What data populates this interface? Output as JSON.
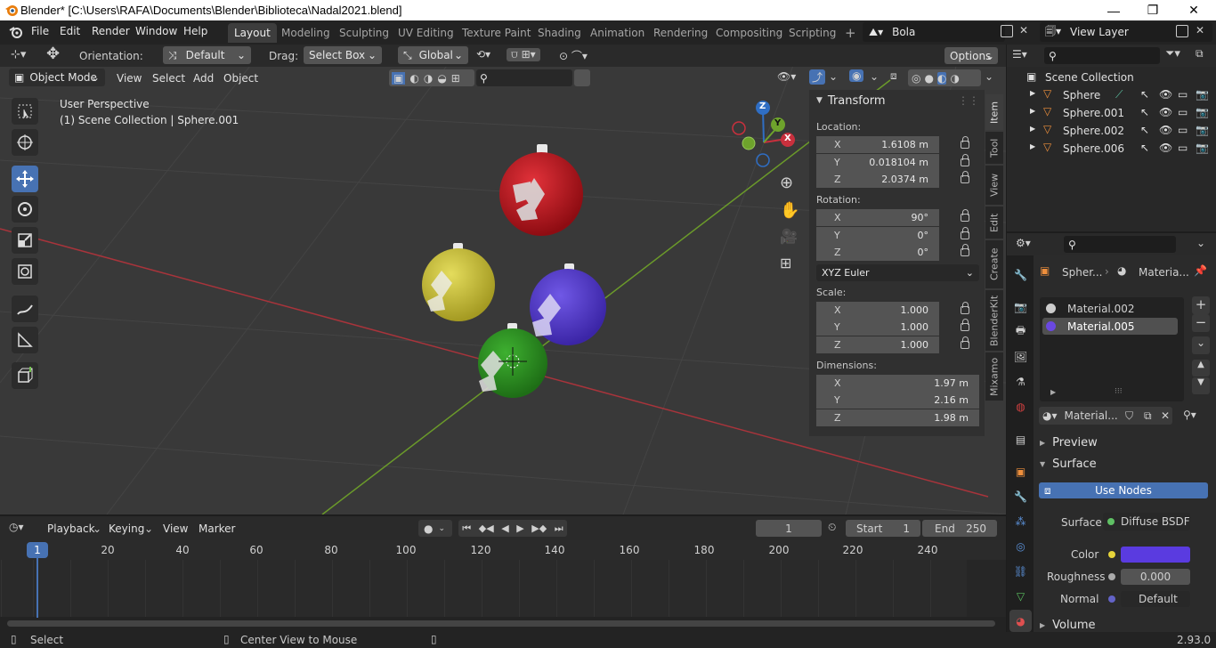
{
  "window": {
    "title": "Blender* [C:\\Users\\RAFA\\Documents\\Blender\\Biblioteca\\Nadal2021.blend]"
  },
  "menu": [
    "File",
    "Edit",
    "Render",
    "Window",
    "Help"
  ],
  "workspaces": [
    "Layout",
    "Modeling",
    "Sculpting",
    "UV Editing",
    "Texture Paint",
    "Shading",
    "Animation",
    "Rendering",
    "Compositing",
    "Scripting"
  ],
  "active_workspace": "Layout",
  "scene_name": "Bola",
  "view_layer": "View Layer",
  "tool_header": {
    "orientation_label": "Orientation:",
    "orientation_value": "Default",
    "drag_label": "Drag:",
    "drag_value": "Select Box",
    "transform_orientation": "Global",
    "options": "Options"
  },
  "viewport_header": {
    "mode": "Object Mode",
    "menus": [
      "View",
      "Select",
      "Add",
      "Object"
    ]
  },
  "viewport_info": {
    "perspective": "User Perspective",
    "collection": "(1) Scene Collection | Sphere.001"
  },
  "gizmo": {
    "x": "X",
    "y": "Y",
    "z": "Z"
  },
  "n_panel": {
    "header": "Transform",
    "location_label": "Location:",
    "location": {
      "x": "1.6108 m",
      "y": "0.018104 m",
      "z": "2.0374 m"
    },
    "rotation_label": "Rotation:",
    "rotation": {
      "x": "90°",
      "y": "0°",
      "z": "0°"
    },
    "rotation_mode": "XYZ Euler",
    "scale_label": "Scale:",
    "scale": {
      "x": "1.000",
      "y": "1.000",
      "z": "1.000"
    },
    "dimensions_label": "Dimensions:",
    "dimensions": {
      "x": "1.97 m",
      "y": "2.16 m",
      "z": "1.98 m"
    },
    "axis": {
      "x": "X",
      "y": "Y",
      "z": "Z"
    },
    "tabs": [
      "Item",
      "Tool",
      "View",
      "Edit",
      "Create",
      "BlenderKit",
      "Mixamo"
    ]
  },
  "outliner": {
    "root": "Scene Collection",
    "items": [
      "Sphere",
      "Sphere.001",
      "Sphere.002",
      "Sphere.006"
    ]
  },
  "properties": {
    "breadcrumb_object": "Spher...",
    "breadcrumb_material": "Materia...",
    "materials": [
      "Material.002",
      "Material.005"
    ],
    "active_material_field": "Material...",
    "sections": {
      "preview": "Preview",
      "surface": "Surface",
      "volume": "Volume"
    },
    "use_nodes": "Use Nodes",
    "surface_label": "Surface",
    "surface_value": "Diffuse BSDF",
    "color_label": "Color",
    "color_value": "#5a3be0",
    "roughness_label": "Roughness",
    "roughness_value": "0.000",
    "normal_label": "Normal",
    "normal_value": "Default"
  },
  "timeline": {
    "menus": [
      "Playback",
      "Keying",
      "View",
      "Marker"
    ],
    "current_frame": "1",
    "start_label": "Start",
    "start": "1",
    "end_label": "End",
    "end": "250",
    "ticks": [
      "20",
      "40",
      "60",
      "80",
      "100",
      "120",
      "140",
      "160",
      "180",
      "200",
      "220",
      "240"
    ],
    "playhead": "1"
  },
  "statusbar": {
    "select": "Select",
    "center": "Center View to Mouse",
    "version": "2.93.0"
  },
  "colors": {
    "accent": "#4772b3",
    "red_ball": "#c4141e",
    "yellow_ball": "#cfc53a",
    "purple_ball": "#5b3ed2",
    "green_ball": "#2e9a25"
  }
}
